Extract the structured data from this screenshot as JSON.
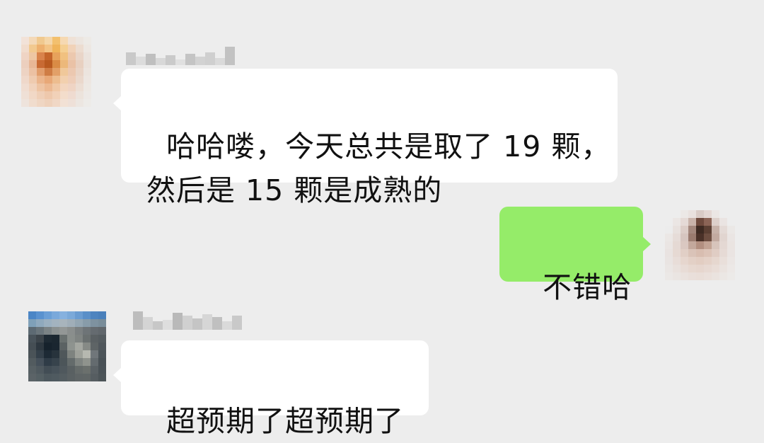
{
  "chat": {
    "messages": [
      {
        "side": "left",
        "sender": "blurred-contact-1",
        "text": "哈哈喽，今天总共是取了 19 颗，\n然后是 15 颗是成熟的"
      },
      {
        "side": "right",
        "sender": "me",
        "text": "不错哈"
      },
      {
        "side": "left",
        "sender": "blurred-contact-2",
        "text": "超预期了超预期了"
      }
    ]
  },
  "colors": {
    "background": "#ededed",
    "incoming_bubble": "#ffffff",
    "outgoing_bubble": "#95ec69"
  }
}
